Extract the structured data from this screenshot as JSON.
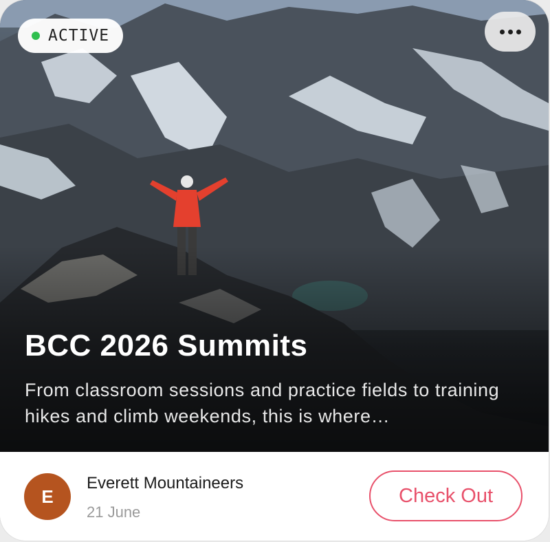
{
  "card": {
    "status": {
      "label": "ACTIVE",
      "dot_color": "#2fbf4f"
    },
    "menu_icon": "more-horizontal-icon",
    "hero_image": "mountaineer-on-summit-photo",
    "title": "BCC 2026 Summits",
    "description": "From classroom sessions and practice fields to training hikes and climb weekends, this is where…",
    "organizer": {
      "avatar_initial": "E",
      "avatar_color": "#b5541f",
      "name": "Everett Mountaineers",
      "date": "21 June"
    },
    "cta": {
      "label": "Check Out",
      "color": "#e8506a"
    }
  }
}
